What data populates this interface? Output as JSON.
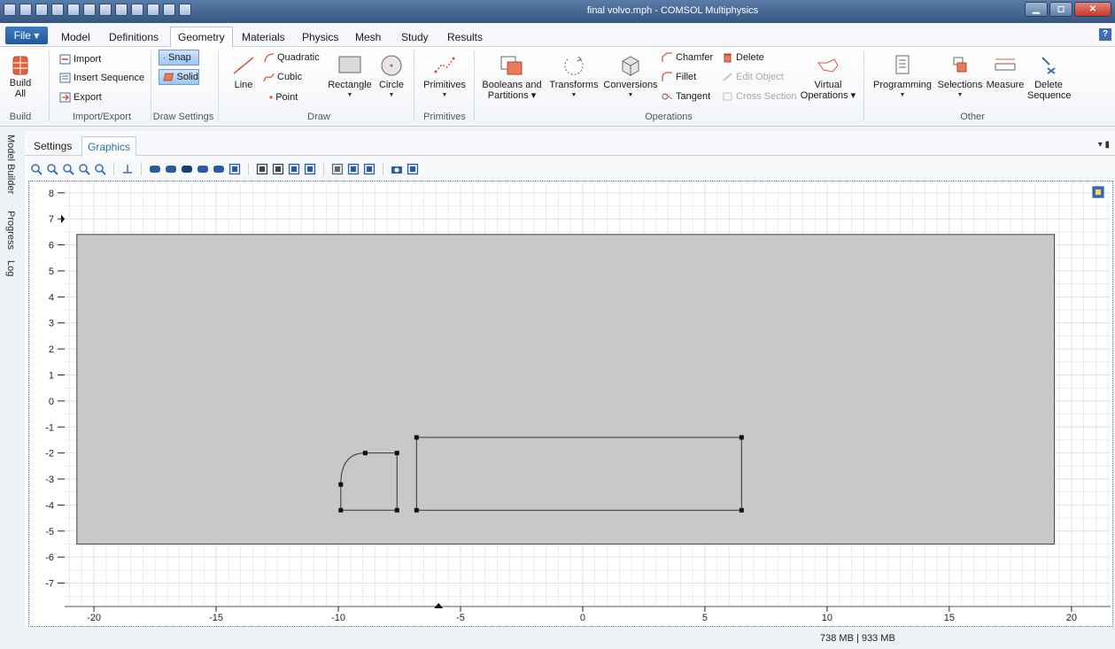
{
  "window": {
    "title": "final volvo.mph - COMSOL Multiphysics",
    "controls": [
      "minimize",
      "maximize",
      "close"
    ]
  },
  "file_menu": "File ▾",
  "tabs": [
    {
      "label": "Model"
    },
    {
      "label": "Definitions"
    },
    {
      "label": "Geometry",
      "active": true
    },
    {
      "label": "Materials"
    },
    {
      "label": "Physics"
    },
    {
      "label": "Mesh"
    },
    {
      "label": "Study"
    },
    {
      "label": "Results"
    }
  ],
  "ribbon": {
    "build": {
      "label_line1": "Build",
      "label_line2": "All",
      "group": "Build"
    },
    "import_export": {
      "import": "Import",
      "insert_sequence": "Insert Sequence",
      "export": "Export",
      "group": "Import/Export"
    },
    "draw_settings": {
      "snap": "Snap",
      "solid": "Solid",
      "group": "Draw Settings"
    },
    "draw": {
      "line": "Line",
      "quadratic": "Quadratic",
      "cubic": "Cubic",
      "point": "Point",
      "rectangle": "Rectangle",
      "circle": "Circle",
      "group": "Draw"
    },
    "primitives": {
      "label": "Primitives",
      "group": "Primitives"
    },
    "operations": {
      "booleans_line1": "Booleans and",
      "booleans_line2": "Partitions ▾",
      "transforms": "Transforms",
      "conversions": "Conversions",
      "chamfer": "Chamfer",
      "fillet": "Fillet",
      "tangent": "Tangent",
      "delete": "Delete",
      "edit_object": "Edit Object",
      "cross_section": "Cross Section",
      "virtual_line1": "Virtual",
      "virtual_line2": "Operations ▾",
      "group": "Operations"
    },
    "other": {
      "programming": "Programming",
      "selections": "Selections",
      "measure": "Measure",
      "delete_seq_line1": "Delete",
      "delete_seq_line2": "Sequence",
      "group": "Other"
    }
  },
  "side_tabs": [
    "Model Builder",
    "Progress",
    "Log"
  ],
  "panel": {
    "tabs": [
      "Settings",
      "Graphics"
    ],
    "active_tab": "Graphics",
    "menu": "▾ ▮"
  },
  "graphics_toolbar_icons": [
    "zoom-in-icon",
    "zoom-out-icon",
    "zoom-box-icon",
    "zoom-selected-icon",
    "zoom-extents-icon",
    "axis-icon",
    "select-objects-icon",
    "select-domains-icon",
    "select-boundaries-icon",
    "select-edges-icon",
    "select-points-icon",
    "clear-selection-icon",
    "transparency-icon",
    "wireframe-icon",
    "render-icon",
    "grid-icon",
    "hide-icon",
    "show-icon",
    "reset-icon",
    "camera-icon",
    "print-icon"
  ],
  "plot": {
    "x_ticks": [
      "-20",
      "-15",
      "-10",
      "-5",
      "0",
      "5",
      "10",
      "15",
      "20"
    ],
    "y_ticks": [
      "8",
      "7",
      "6",
      "5",
      "4",
      "3",
      "2",
      "1",
      "0",
      "-1",
      "-2",
      "-3",
      "-4",
      "-5",
      "-6",
      "-7"
    ],
    "xlim": [
      -21.2,
      21.6
    ],
    "ylim": [
      -7.9,
      8.3
    ],
    "domain": {
      "x0": -20.7,
      "x1": 19.3,
      "y0": -5.5,
      "y1": 6.4,
      "fill": "#c8c8c8"
    },
    "rect": {
      "x0": -6.8,
      "x1": 6.5,
      "y0": -4.2,
      "y1": -1.4
    },
    "rounded_shape": {
      "x0": -9.9,
      "x1": -7.6,
      "y0": -4.2,
      "y1": -2.0,
      "corner": [
        -8.9,
        -2.0
      ]
    },
    "grid_color": "#d6e4ee"
  },
  "status": {
    "memory": "738 MB | 933 MB"
  }
}
